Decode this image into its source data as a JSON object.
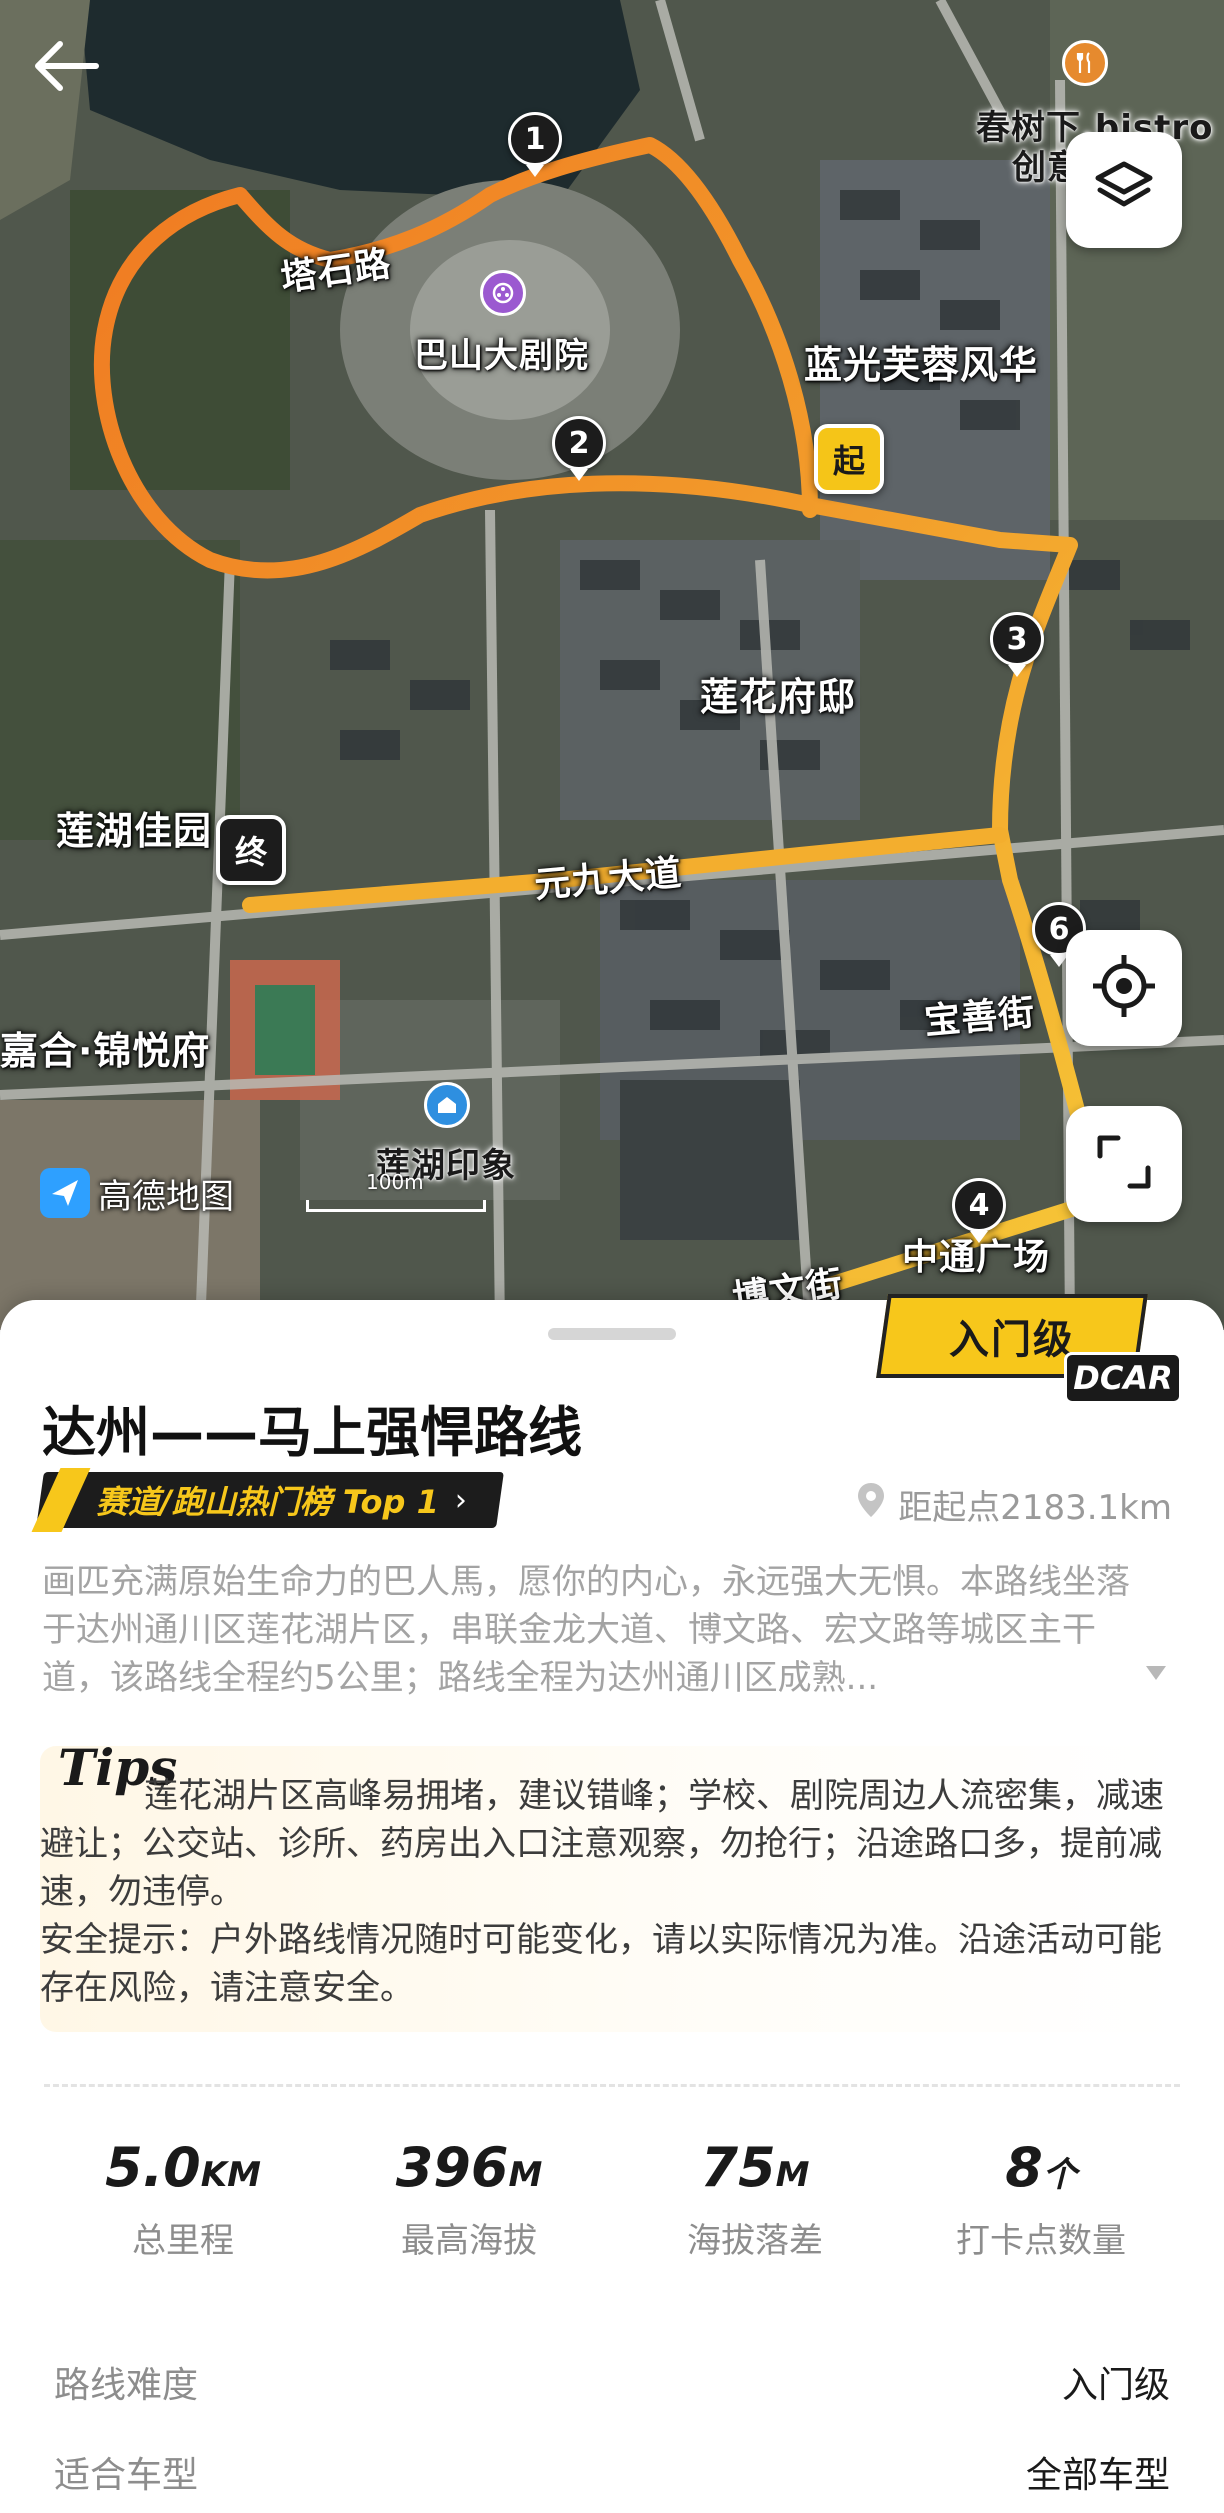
{
  "map": {
    "labels": {
      "restaurant": "春树下.bistro",
      "restaurant2": "创意",
      "theater": "巴山大剧院",
      "road_top": "塔石路",
      "lanzhou": "蓝光芙蓉风华",
      "lianhua_fudi": "莲花府邸",
      "lianhu_jiayuan": "莲湖佳园",
      "yuanjiu_dadao": "元九大道",
      "jiahe": "嘉合·锦悦府",
      "baoshan_jie": "宝善街",
      "lianhu_yinxiang": "莲湖印象",
      "bowen": "博文街",
      "plaza": "中通广场"
    },
    "waypoints": [
      "1",
      "2",
      "3",
      "4",
      "6"
    ],
    "start_label": "起",
    "end_label": "终",
    "provider": "高德地图",
    "scale": "100m",
    "icons": {
      "back": "back-arrow-icon",
      "layers": "layers-icon",
      "locate": "locate-icon",
      "fullscreen": "fullscreen-icon"
    }
  },
  "route": {
    "level_badge": "入门级",
    "brand": "DCAR",
    "title": "达州——马上强悍路线",
    "rank_tag": "赛道/跑山热门榜 Top 1",
    "rank_chevron": "›",
    "distance_from_start": "距起点2183.1km",
    "description": "画匹充满原始生命力的巴人馬，愿你的内心，永远强大无惧。本路线坐落于达州通川区莲花湖片区，串联金龙大道、博文路、宏文路等城区主干道，该路线全程约5公里；路线全程为达州通川区成熟...",
    "tips_title": "Tips",
    "tips_text": "莲花湖片区高峰易拥堵，建议错峰；学校、剧院周边人流密集，减速避让；公交站、诊所、药房出入口注意观察，勿抢行；沿途路口多，提前减速，勿违停。",
    "safety_text": "安全提示：户外路线情况随时可能变化，请以实际情况为准。沿途活动可能存在风险，请注意安全。",
    "stats": [
      {
        "value": "5.0",
        "unit": "KM",
        "label": "总里程"
      },
      {
        "value": "396",
        "unit": "M",
        "label": "最高海拔"
      },
      {
        "value": "75",
        "unit": "M",
        "label": "海拔落差"
      },
      {
        "value": "8",
        "unit": "个",
        "label": "打卡点数量"
      }
    ],
    "difficulty_label": "路线难度",
    "difficulty_value": "入门级",
    "vehicle_label": "适合车型",
    "vehicle_value": "全部车型"
  },
  "colors": {
    "accent_yellow": "#f7c71b",
    "route_orange": "#f08a24",
    "route_yellow": "#f6d43a"
  }
}
